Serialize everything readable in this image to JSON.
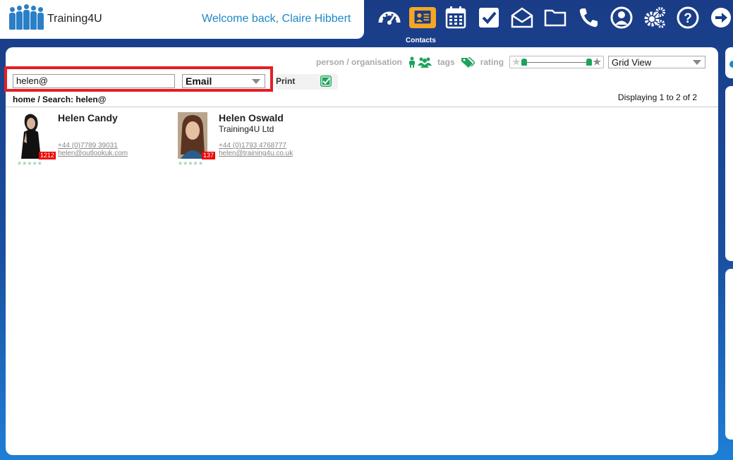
{
  "header": {
    "logo_text": "Training4U",
    "welcome": "Welcome back, Claire Hibbert",
    "nav_items": [
      {
        "icon": "dashboard-icon"
      },
      {
        "icon": "contacts-icon",
        "active": true,
        "caption": "Contacts"
      },
      {
        "icon": "calendar-icon"
      },
      {
        "icon": "tasks-icon"
      },
      {
        "icon": "mail-icon"
      },
      {
        "icon": "folder-icon"
      },
      {
        "icon": "phone-icon"
      },
      {
        "icon": "user-icon"
      },
      {
        "icon": "settings-icon"
      },
      {
        "icon": "help-icon"
      },
      {
        "icon": "logout-icon"
      }
    ],
    "active_caption": "Contacts"
  },
  "filters": {
    "person_org_label": "person / organisation",
    "tags_label": "tags",
    "rating_label": "rating",
    "rating_range": [
      0,
      1
    ],
    "view_select": "Grid View"
  },
  "search": {
    "value": "helen@",
    "field": "Email",
    "print_label": "Print",
    "print_checked": true
  },
  "breadcrumb": "home / Search: helen@",
  "displaying": "Displaying 1 to 2 of 2",
  "contacts": [
    {
      "name": "Helen Candy",
      "organisation": "",
      "phone": "+44 (0)7789 39031",
      "email": "helen@outlookuk.com",
      "badge": "1212",
      "stars": "★★★★★"
    },
    {
      "name": "Helen Oswald",
      "organisation": "Training4U Ltd",
      "phone": "+44 (0)1793 4768777",
      "email": "helen@training4u.co.uk",
      "badge": "137",
      "stars": "★★★★★"
    }
  ],
  "colors": {
    "nav_bg": "#1a3c86",
    "accent": "#1e88c7",
    "active_tab": "#f5a623",
    "highlight": "#e41e26",
    "green": "#1fa35c"
  }
}
